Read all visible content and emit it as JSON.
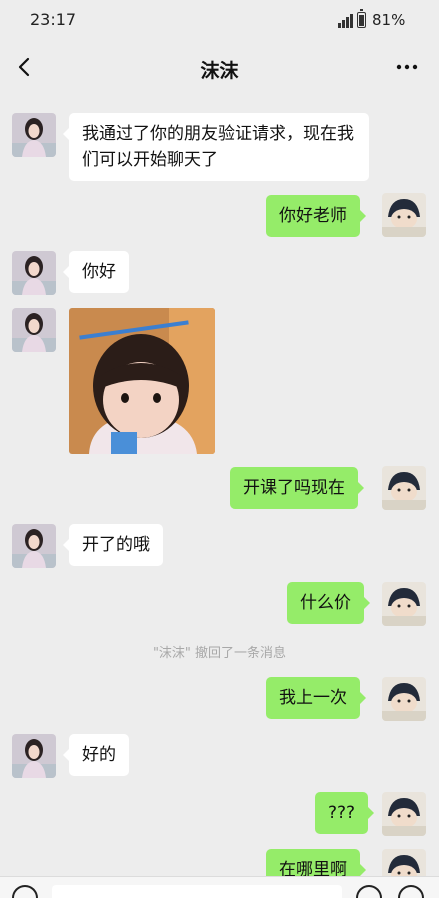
{
  "status_bar": {
    "time": "23:17",
    "battery": "81%"
  },
  "header": {
    "title": "沫沫"
  },
  "messages": [
    {
      "side": "left",
      "text": "我通过了你的朋友验证请求，现在我们可以开始聊天了"
    },
    {
      "side": "right",
      "text": "你好老师"
    },
    {
      "side": "left",
      "text": "你好"
    },
    {
      "side": "left",
      "type": "sticker"
    },
    {
      "side": "right",
      "text": "开课了吗现在"
    },
    {
      "side": "left",
      "text": "开了的哦"
    },
    {
      "side": "right",
      "text": "什么价"
    },
    {
      "side": "system",
      "text": "\"沫沫\" 撤回了一条消息"
    },
    {
      "side": "right",
      "text": "我上一次"
    },
    {
      "side": "left",
      "text": "好的"
    },
    {
      "side": "right",
      "text": "???"
    },
    {
      "side": "right",
      "text": "在哪里啊"
    }
  ],
  "colors": {
    "background": "#ededed",
    "own_bubble": "#95ec69",
    "other_bubble": "#ffffff"
  }
}
